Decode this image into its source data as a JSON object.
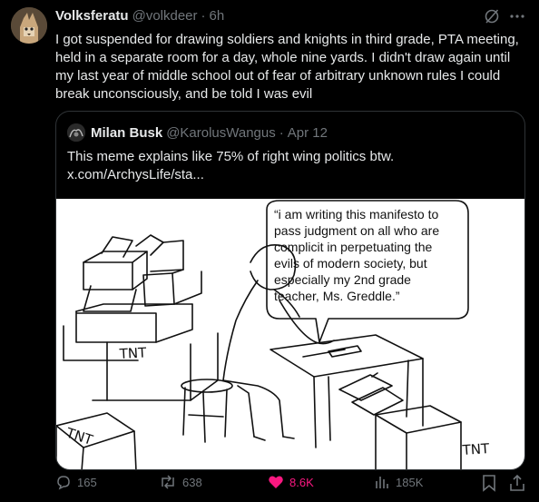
{
  "post": {
    "author_name": "Volksferatu",
    "author_handle": "@volkdeer",
    "separator": "·",
    "time": "6h",
    "text": "I got suspended for drawing soldiers and knights in third grade, PTA meeting, held in a separate room for a day, whole nine yards. I didn't draw again until my last year of middle school out of fear of arbitrary unknown rules I could break unconsciously, and be told I was evil"
  },
  "quote": {
    "author_name": "Milan Busk",
    "author_handle": "@KarolusWangus",
    "separator": "·",
    "date": "Apr 12",
    "text": "This meme explains like 75% of right wing politics btw.  x.com/ArchysLife/sta...",
    "comic": {
      "bubble_lines": [
        "“i am writing this manifesto to",
        "pass judgment on all who are",
        "complicit in perpetuating the",
        "evils of modern society, but",
        "especially my 2nd grade",
        "teacher, Ms. Greddle.”"
      ],
      "box_labels": [
        "TNT",
        "TNT",
        "TNT"
      ]
    }
  },
  "actions": {
    "replies": "165",
    "reposts": "638",
    "likes": "8.6K",
    "views": "185K"
  },
  "colors": {
    "background": "#000000",
    "text": "#e7e9ea",
    "secondary": "#71767b",
    "like": "#f91880",
    "border": "#2f3336"
  },
  "icons": [
    "grok-icon",
    "more-icon",
    "reply-icon",
    "repost-icon",
    "like-icon",
    "views-icon",
    "bookmark-icon",
    "share-icon"
  ]
}
